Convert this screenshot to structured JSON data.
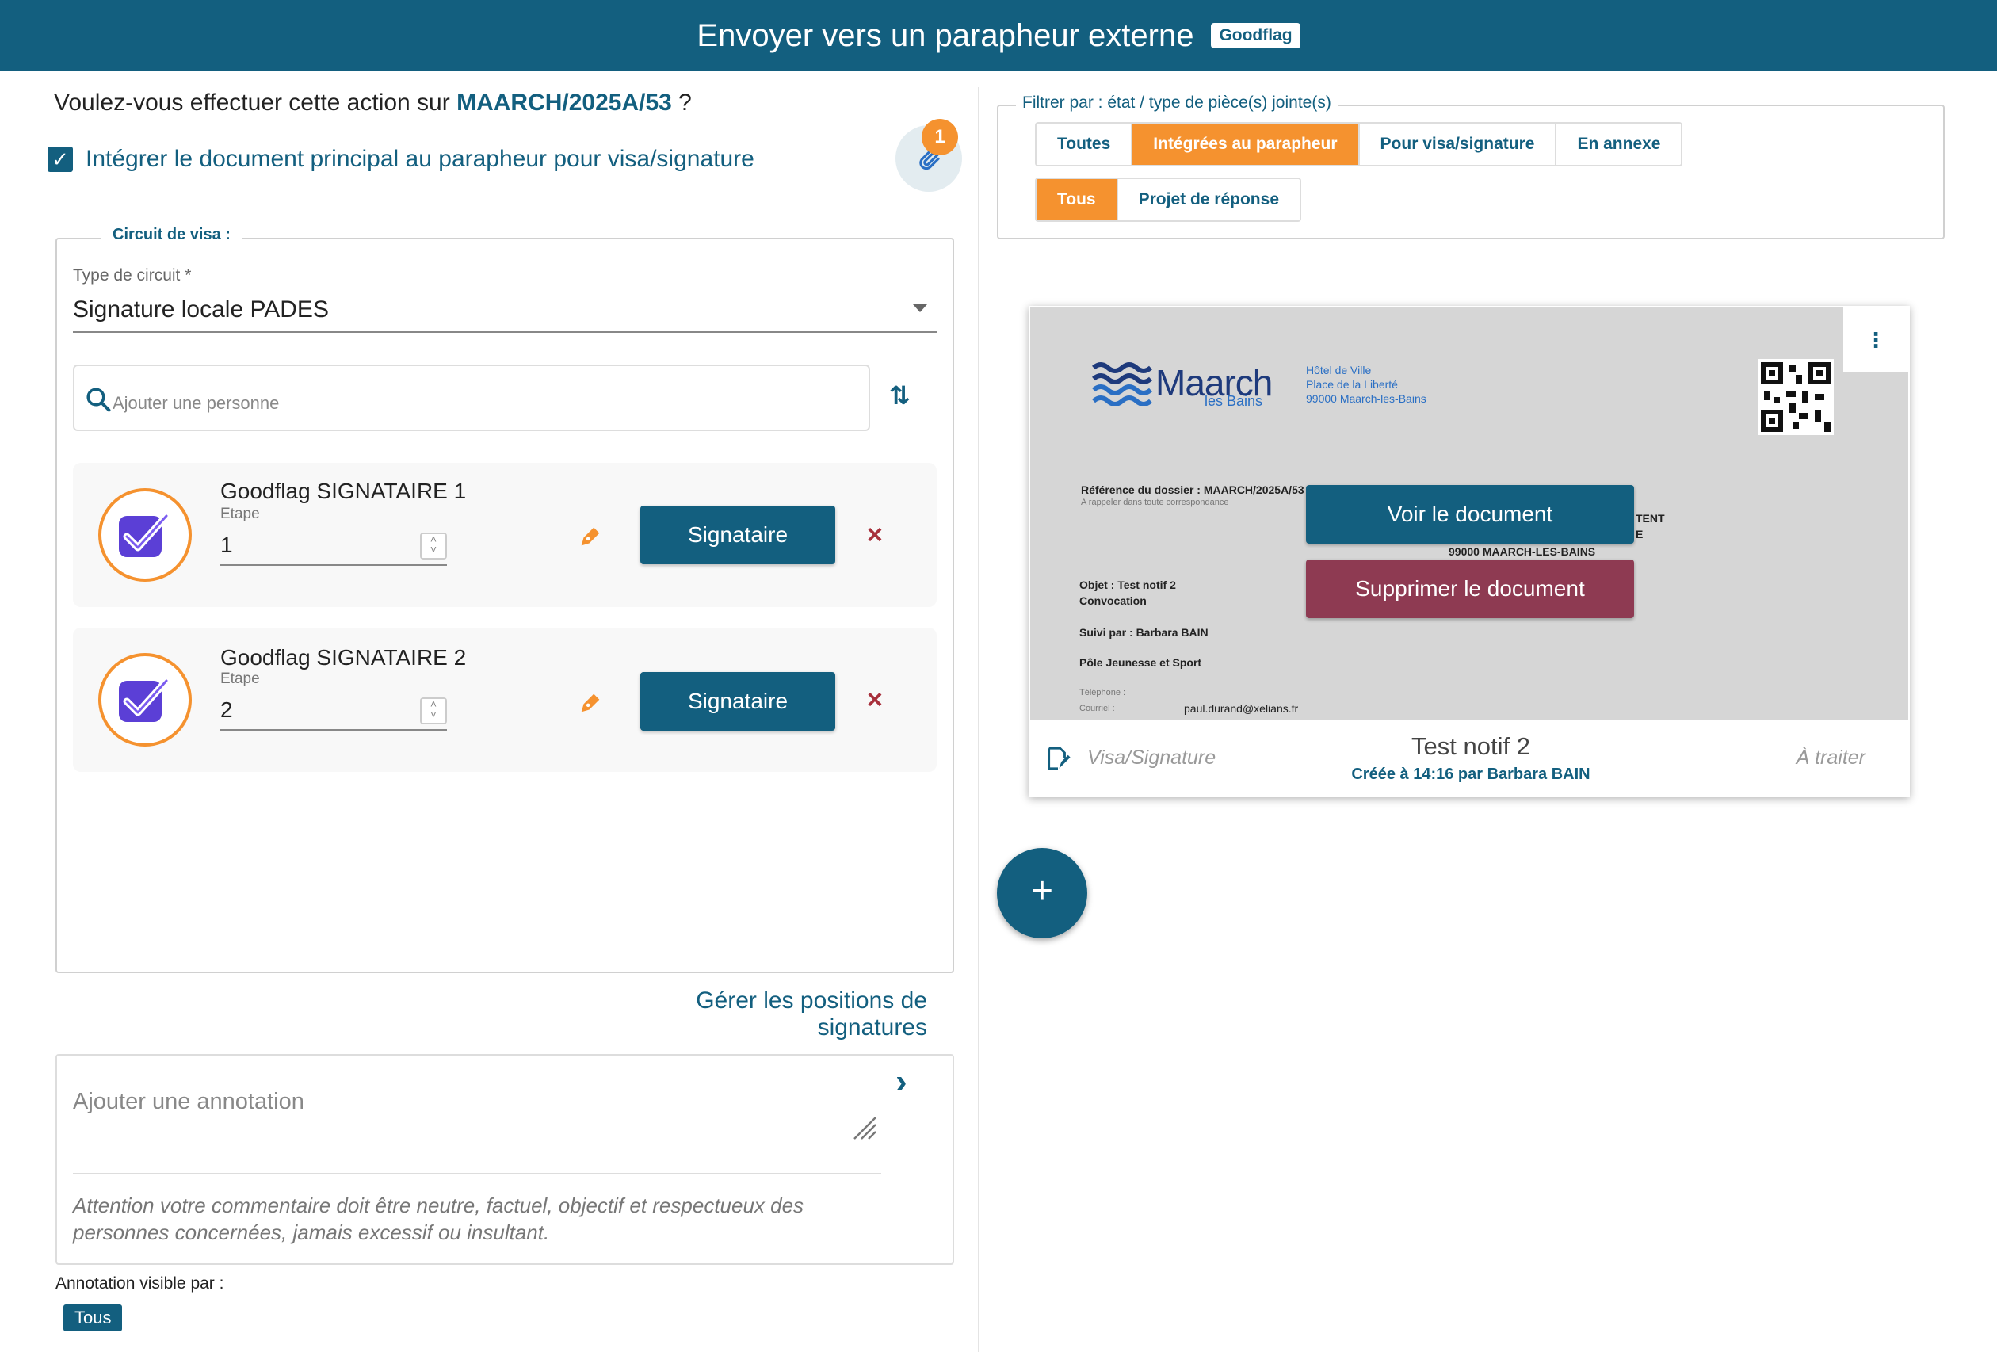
{
  "header": {
    "title": "Envoyer vers un parapheur externe",
    "badge": "Goodflag"
  },
  "question": {
    "prefix": "Voulez-vous effectuer cette action sur ",
    "reference": "MAARCH/2025A/53",
    "suffix": " ?"
  },
  "integrate_main_doc": {
    "checked": true,
    "label": "Intégrer le document principal au parapheur pour visa/signature"
  },
  "attachments_badge": "1",
  "circuit": {
    "legend": "Circuit de visa :",
    "type_label": "Type de circuit *",
    "type_value": "Signature locale PADES",
    "search_placeholder": "Ajouter une personne",
    "signers": [
      {
        "name": "Goodflag SIGNATAIRE 1",
        "etape_label": "Etape",
        "step": "1",
        "role": "Signataire"
      },
      {
        "name": "Goodflag SIGNATAIRE 2",
        "etape_label": "Etape",
        "step": "2",
        "role": "Signataire"
      }
    ]
  },
  "manage_positions_link": "Gérer les positions de signatures",
  "annotation": {
    "placeholder": "Ajouter une annotation",
    "warning": "Attention votre commentaire doit être neutre, factuel, objectif et respectueux des personnes concernées, jamais excessif ou insultant.",
    "visible_by_label": "Annotation visible par :",
    "visible_by_chip": "Tous"
  },
  "filter": {
    "legend": "Filtrer par : état / type de pièce(s) jointe(s)",
    "state_tabs": [
      "Toutes",
      "Intégrées au parapheur",
      "Pour visa/signature",
      "En annexe"
    ],
    "state_active": 1,
    "type_tabs": [
      "Tous",
      "Projet de réponse"
    ],
    "type_active": 0
  },
  "document": {
    "preview": {
      "logo_text": "Maarch",
      "logo_sub": "les Bains",
      "address_lines": [
        "Hôtel de Ville",
        "Place de la Liberté",
        "99000 Maarch-les-Bains"
      ],
      "reference_line": "Référence du dossier : MAARCH/2025A/53",
      "reference_note": "A rappeler dans toute correspondance",
      "recipient_fragment_1": "TENT",
      "recipient_fragment_2": "E",
      "recipient_city": "99000 MAARCH-LES-BAINS",
      "object_line": "Objet : Test notif 2",
      "object_sub": "Convocation",
      "followed_by": "Suivi par : Barbara BAIN",
      "department": "Pôle Jeunesse et Sport",
      "phone_label": "Téléphone :",
      "email_label": "Courriel :",
      "email_value": "paul.durand@xelians.fr"
    },
    "view_button": "Voir le document",
    "delete_button": "Supprimer le document",
    "type": "Visa/Signature",
    "title": "Test notif 2",
    "meta": "Créée à 14:16 par Barbara BAIN",
    "status": "À traiter"
  },
  "colors": {
    "primary": "#135f7f",
    "accent": "#f5922f",
    "danger": "#a8303c",
    "delete_button": "#8e3a52"
  }
}
